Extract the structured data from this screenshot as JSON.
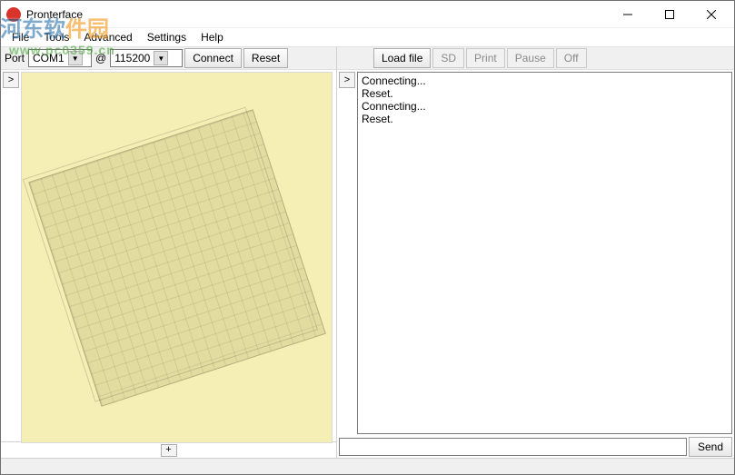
{
  "window": {
    "title": "Pronterface"
  },
  "menus": {
    "file": "File",
    "tools": "Tools",
    "advanced": "Advanced",
    "settings": "Settings",
    "help": "Help"
  },
  "toolbar": {
    "port_label": "Port",
    "port_value": "COM1",
    "at_label": "@",
    "baud_value": "115200",
    "connect": "Connect",
    "reset": "Reset"
  },
  "right_toolbar": {
    "load_file": "Load file",
    "sd": "SD",
    "print": "Print",
    "pause": "Pause",
    "off": "Off"
  },
  "left": {
    "toggle": ">",
    "plus": "+"
  },
  "console": {
    "toggle": ">",
    "lines": "Connecting...\nReset.\nConnecting...\nReset."
  },
  "command": {
    "value": "",
    "send": "Send"
  },
  "watermark": {
    "line1_a": "河东软",
    "line1_b": "件园",
    "url": "www.pc0359.cn"
  }
}
